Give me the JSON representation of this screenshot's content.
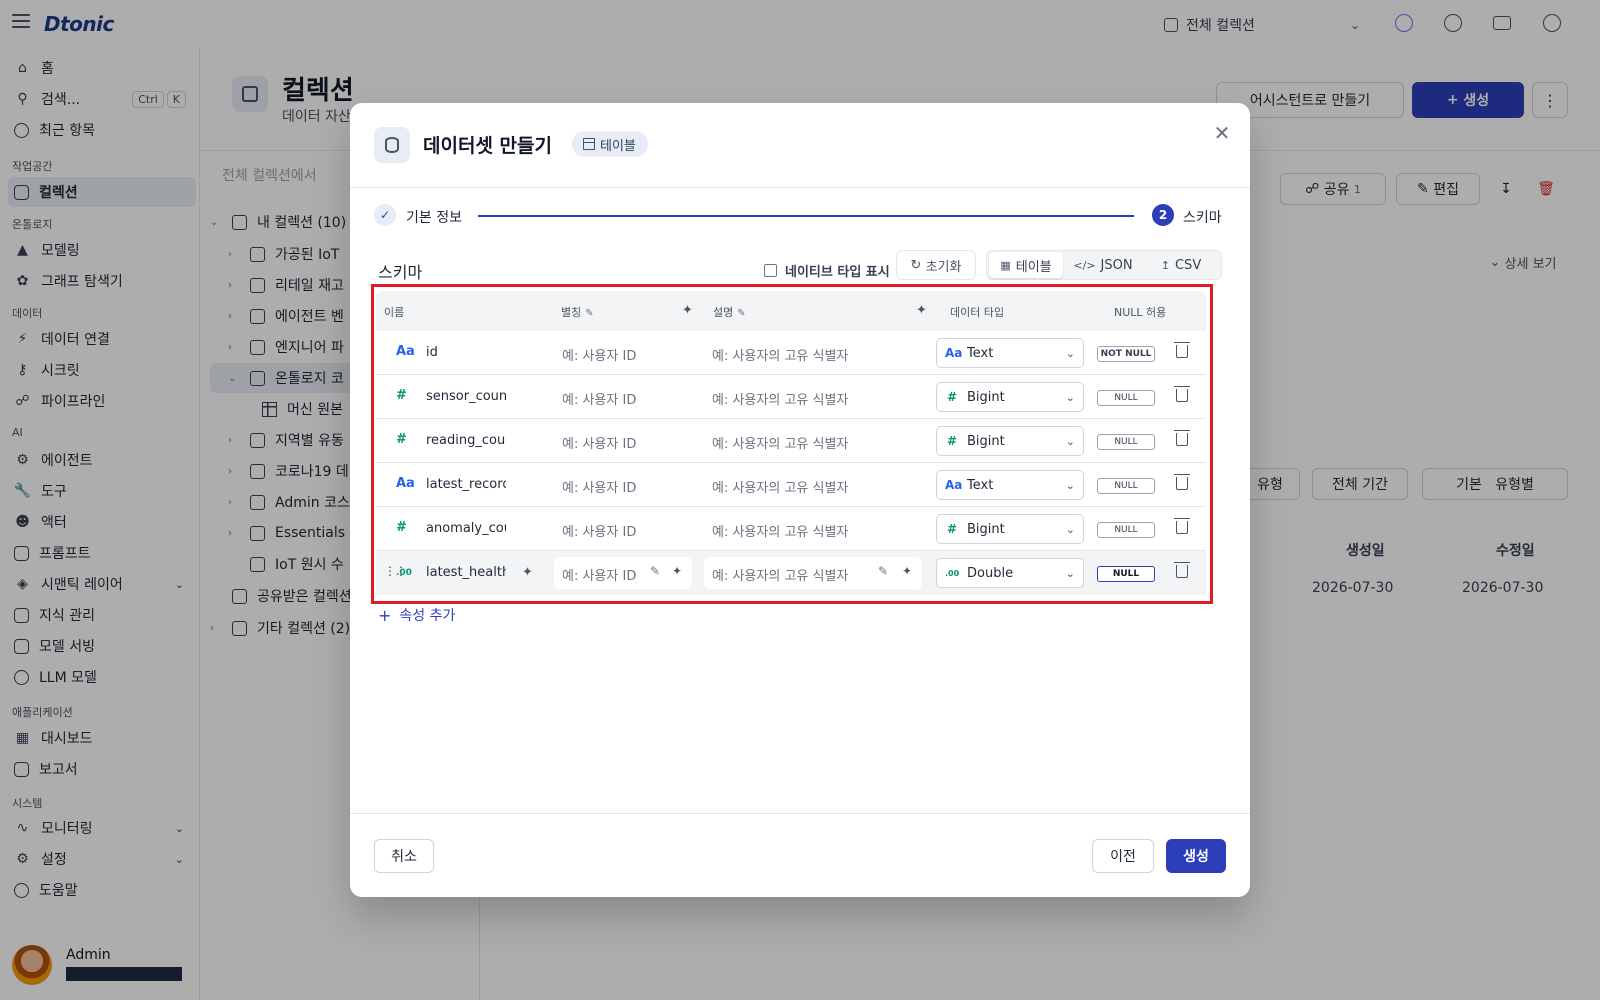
{
  "app": {
    "logo": "Dtonic",
    "collection_selector": "전체 컬렉션",
    "search_label": "검색...",
    "kbd": [
      "Ctrl",
      "K"
    ]
  },
  "sidebar": {
    "top_items": [
      {
        "label": "홈",
        "icon": "home-icon"
      },
      {
        "label": "최근 항목",
        "icon": "clock-icon"
      }
    ],
    "sections": [
      {
        "label": "작업공간",
        "items": [
          {
            "label": "컬렉션",
            "icon": "cube-icon",
            "active": true
          }
        ]
      },
      {
        "label": "온톨로지",
        "items": [
          {
            "label": "모델링"
          },
          {
            "label": "그래프 탐색기"
          }
        ]
      },
      {
        "label": "데이터",
        "items": [
          {
            "label": "데이터 연결"
          },
          {
            "label": "시크릿"
          },
          {
            "label": "파이프라인"
          }
        ]
      },
      {
        "label": "AI",
        "items": [
          {
            "label": "에이전트"
          },
          {
            "label": "도구"
          },
          {
            "label": "액터"
          },
          {
            "label": "프롬프트"
          },
          {
            "label": "시맨틱 레이어"
          },
          {
            "label": "지식 관리"
          },
          {
            "label": "모델 서빙"
          },
          {
            "label": "LLM 모델"
          }
        ]
      },
      {
        "label": "애플리케이션",
        "items": [
          {
            "label": "대시보드"
          },
          {
            "label": "보고서"
          }
        ]
      },
      {
        "label": "시스템",
        "items": [
          {
            "label": "모니터링"
          },
          {
            "label": "설정"
          },
          {
            "label": "도움말"
          }
        ]
      }
    ],
    "user_name": "Admin"
  },
  "page": {
    "title": "컬렉션",
    "subtitle": "데이터 자산",
    "assistant_button": "어시스턴트로 만들기",
    "create_button": "생성",
    "tree_search_placeholder": "전체 컬렉션에서",
    "tree": [
      "내 컬렉션 (10)",
      "가공된 IoT",
      "리테일 재고",
      "에이전트 벤",
      "엔지니어 파",
      "온톨로지 코",
      "머신 원본",
      "지역별 유동",
      "코로나19 데",
      "Admin 코스",
      "Essentials",
      "IoT 원시 수",
      "공유받은 컬렉션",
      "기타 컬렉션 (2)"
    ],
    "share_label": "공유",
    "share_count": "1",
    "edit_label": "편집",
    "detail_view": "상세 보기",
    "filter_type": "유형",
    "filter_period": "전체 기간",
    "view_basic": "기본",
    "view_by_type": "유형별",
    "col_created": "생성일",
    "col_modified": "수정일",
    "created_date": "2026-07-30",
    "modified_date": "2026-07-30"
  },
  "modal": {
    "title": "데이터셋 만들기",
    "badge": "테이블",
    "steps": [
      {
        "num": "1",
        "label": "기본 정보",
        "done": true
      },
      {
        "num": "2",
        "label": "스키마",
        "active": true
      }
    ],
    "schema_title": "스키마",
    "native_type_label": "네이티브 타입 표시",
    "reset_label": "초기화",
    "view_tabs": [
      {
        "label": "테이블",
        "active": true
      },
      {
        "label": "JSON"
      },
      {
        "label": "CSV"
      }
    ],
    "columns": {
      "name": "이름",
      "alias": "별칭",
      "description": "설명",
      "data_type": "데이터 타입",
      "nullable": "NULL 허용"
    },
    "rows": [
      {
        "name": "id",
        "kind": "text",
        "glyph": "Aa",
        "alias_placeholder": "예: 사용자 ID",
        "desc_placeholder": "예: 사용자의 고유 식별자",
        "type": "Text",
        "null": "NOT NULL"
      },
      {
        "name": "sensor_count",
        "kind": "num",
        "glyph": "#",
        "alias_placeholder": "예: 사용자 ID",
        "desc_placeholder": "예: 사용자의 고유 식별자",
        "type": "Bigint",
        "null": "NULL"
      },
      {
        "name": "reading_count",
        "kind": "num",
        "glyph": "#",
        "alias_placeholder": "예: 사용자 ID",
        "desc_placeholder": "예: 사용자의 고유 식별자",
        "type": "Bigint",
        "null": "NULL"
      },
      {
        "name": "latest_recorded",
        "kind": "text",
        "glyph": "Aa",
        "alias_placeholder": "예: 사용자 ID",
        "desc_placeholder": "예: 사용자의 고유 식별자",
        "type": "Text",
        "null": "NULL"
      },
      {
        "name": "anomaly_count",
        "kind": "num",
        "glyph": "#",
        "alias_placeholder": "예: 사용자 ID",
        "desc_placeholder": "예: 사용자의 고유 식별자",
        "type": "Bigint",
        "null": "NULL"
      },
      {
        "name": "latest_health_score",
        "kind": "dbl",
        "glyph": ".00",
        "alias_placeholder": "예: 사용자 ID",
        "desc_placeholder": "예: 사용자의 고유 식별자",
        "type": "Double",
        "null": "NULL"
      }
    ],
    "add_attribute": "속성 추가",
    "cancel": "취소",
    "prev": "이전",
    "create": "생성"
  },
  "colors": {
    "primary": "#2d3fb8",
    "highlight": "#e11d2a",
    "text_type": "#2563eb",
    "number_type": "#059669"
  }
}
